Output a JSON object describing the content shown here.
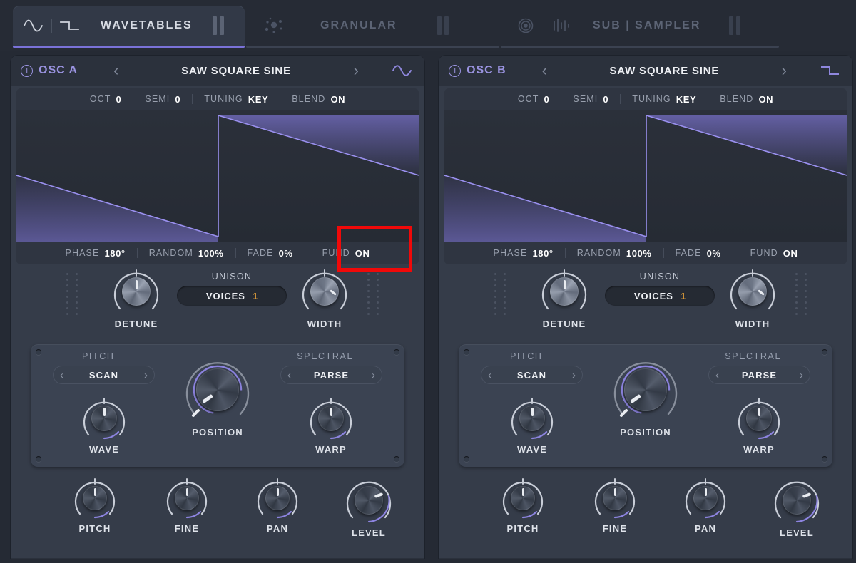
{
  "tabs": [
    {
      "label": "WAVETABLES",
      "active": true,
      "icons": [
        "sine-wave-icon",
        "square-wave-icon"
      ],
      "pause_icon": "pause-bars-icon"
    },
    {
      "label": "GRANULAR",
      "active": false,
      "icons": [
        "granular-dots-icon"
      ],
      "pause_icon": "pause-bars-icon"
    },
    {
      "label": "SUB | SAMPLER",
      "active": false,
      "icons": [
        "sub-circle-icon",
        "sampler-waveform-icon"
      ],
      "pause_icon": "pause-bars-icon"
    }
  ],
  "oscillators": [
    {
      "id": "osc-a",
      "title": "OSC A",
      "info_icon": "info-circle-icon",
      "prev_icon": "chevron-left-icon",
      "next_icon": "chevron-right-icon",
      "preset": "SAW SQUARE SINE",
      "type_icon": "sine-wave-icon",
      "top_params": [
        {
          "key": "OCT",
          "value": "0"
        },
        {
          "key": "SEMI",
          "value": "0"
        },
        {
          "key": "TUNING",
          "value": "KEY"
        },
        {
          "key": "BLEND",
          "value": "ON"
        }
      ],
      "bottom_params": [
        {
          "key": "PHASE",
          "value": "180°"
        },
        {
          "key": "RANDOM",
          "value": "100%"
        },
        {
          "key": "FADE",
          "value": "0%"
        },
        {
          "key": "FUND",
          "value": "ON"
        }
      ],
      "unison": {
        "caption": "UNISON",
        "voices_label": "VOICES",
        "voices_value": "1",
        "detune_label": "DETUNE",
        "width_label": "WIDTH"
      },
      "mod": {
        "pitch_label": "PITCH",
        "pitch_mode": "SCAN",
        "spectral_label": "SPECTRAL",
        "spectral_mode": "PARSE",
        "wave_label": "WAVE",
        "position_label": "POSITION",
        "warp_label": "WARP"
      },
      "bottom_knobs": [
        "PITCH",
        "FINE",
        "PAN",
        "LEVEL"
      ]
    },
    {
      "id": "osc-b",
      "title": "OSC B",
      "info_icon": "info-circle-icon",
      "prev_icon": "chevron-left-icon",
      "next_icon": "chevron-right-icon",
      "preset": "SAW SQUARE SINE",
      "type_icon": "square-wave-icon",
      "top_params": [
        {
          "key": "OCT",
          "value": "0"
        },
        {
          "key": "SEMI",
          "value": "0"
        },
        {
          "key": "TUNING",
          "value": "KEY"
        },
        {
          "key": "BLEND",
          "value": "ON"
        }
      ],
      "bottom_params": [
        {
          "key": "PHASE",
          "value": "180°"
        },
        {
          "key": "RANDOM",
          "value": "100%"
        },
        {
          "key": "FADE",
          "value": "0%"
        },
        {
          "key": "FUND",
          "value": "ON"
        }
      ],
      "unison": {
        "caption": "UNISON",
        "voices_label": "VOICES",
        "voices_value": "1",
        "detune_label": "DETUNE",
        "width_label": "WIDTH"
      },
      "mod": {
        "pitch_label": "PITCH",
        "pitch_mode": "SCAN",
        "spectral_label": "SPECTRAL",
        "spectral_mode": "PARSE",
        "wave_label": "WAVE",
        "position_label": "POSITION",
        "warp_label": "WARP"
      },
      "bottom_knobs": [
        "PITCH",
        "FINE",
        "PAN",
        "LEVEL"
      ]
    }
  ],
  "annotation": {
    "target": "FUND",
    "color": "#f00909"
  },
  "colors": {
    "accent_purple": "#7a72d8",
    "panel": "#353c49",
    "panel_light": "#3b4352",
    "header": "#2b313c",
    "text": "#eef0f4",
    "text_dim": "#99a0ae",
    "voices_orange": "#e8a33a",
    "annotation_red": "#f00909"
  }
}
